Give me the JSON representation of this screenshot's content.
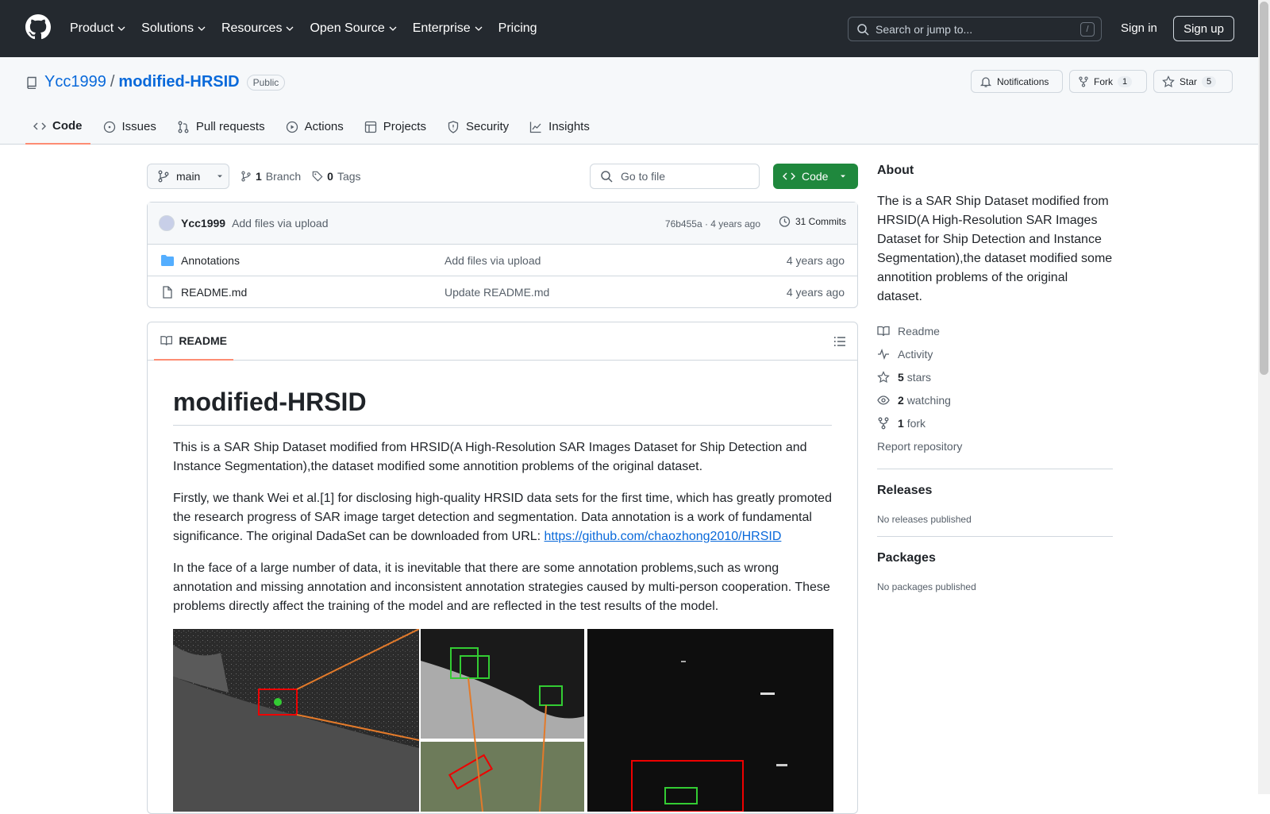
{
  "header": {
    "nav": [
      "Product",
      "Solutions",
      "Resources",
      "Open Source",
      "Enterprise",
      "Pricing"
    ],
    "search_placeholder": "Search or jump to...",
    "search_shortcut": "/",
    "sign_in": "Sign in",
    "sign_up": "Sign up"
  },
  "repo": {
    "owner": "Ycc1999",
    "separator": "/",
    "name": "modified-HRSID",
    "visibility": "Public",
    "notifications_label": "Notifications",
    "fork_label": "Fork",
    "fork_count": "1",
    "star_label": "Star",
    "star_count": "5"
  },
  "tabs": [
    "Code",
    "Issues",
    "Pull requests",
    "Actions",
    "Projects",
    "Security",
    "Insights"
  ],
  "branch": {
    "name": "main",
    "branch_count": "1",
    "branch_label": "Branch",
    "tag_count": "0",
    "tag_label": "Tags",
    "go_to_file": "Go to file",
    "code_button": "Code"
  },
  "commit": {
    "author": "Ycc1999",
    "message": "Add files via upload",
    "hash_time": "76b455a · 4 years ago",
    "commits": "31 Commits"
  },
  "files": [
    {
      "name": "Annotations",
      "type": "folder",
      "message": "Add files via upload",
      "age": "4 years ago"
    },
    {
      "name": "README.md",
      "type": "file",
      "message": "Update README.md",
      "age": "4 years ago"
    }
  ],
  "readme": {
    "tab_label": "README",
    "title": "modified-HRSID",
    "p1": "This is a SAR Ship Dataset modified from HRSID(A High-Resolution SAR Images Dataset for Ship Detection and Instance Segmentation),the dataset modified some annotition problems of the original dataset.",
    "p2_text": "Firstly, we thank Wei et al.[1] for disclosing high-quality HRSID data sets for the first time, which has greatly promoted the research progress of SAR image target detection and segmentation. Data annotation is a work of fundamental significance. The original DadaSet can be downloaded from URL: ",
    "p2_link": "https://github.com/chaozhong2010/HRSID",
    "p3": "In the face of a large number of data, it is inevitable that there are some annotation problems,such as wrong annotation and missing annotation and inconsistent annotation strategies caused by multi-person cooperation. These problems directly affect the training of the model and are reflected in the test results of the model."
  },
  "about": {
    "heading": "About",
    "description": "The is a SAR Ship Dataset modified from HRSID(A High-Resolution SAR Images Dataset for Ship Detection and Instance Segmentation),the dataset modified some annotition problems of the original dataset.",
    "readme": "Readme",
    "activity": "Activity",
    "stars_count": "5",
    "stars_label": "stars",
    "watching_count": "2",
    "watching_label": "watching",
    "fork_count": "1",
    "fork_label": "fork",
    "report": "Report repository"
  },
  "releases": {
    "heading": "Releases",
    "empty": "No releases published"
  },
  "packages": {
    "heading": "Packages",
    "empty": "No packages published"
  },
  "colors": {
    "header_bg": "#24292f",
    "accent": "#0969da",
    "code_green": "#1f883d",
    "tab_underline": "#fd8c73"
  }
}
